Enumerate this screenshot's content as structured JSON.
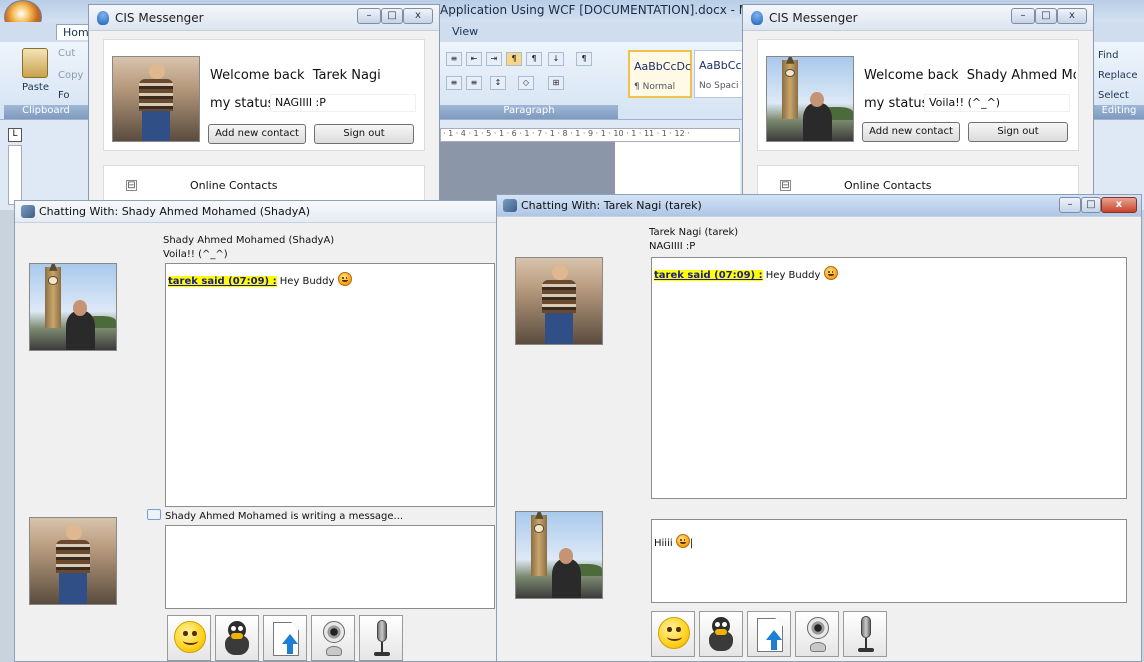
{
  "word": {
    "title": "Application Using WCF [DOCUMENTATION].docx - Microsoft W",
    "tab_home": "Home",
    "tab_view": "View",
    "paste_label": "Paste",
    "cut_label": "Cut",
    "copy_label": "Copy",
    "format_label": "Fo",
    "clipboard_group": "Clipboard",
    "paragraph_group": "Paragraph",
    "editing_group": "Editing",
    "style1_sample": "AaBbCcDc",
    "style1_name": "¶ Normal",
    "style2_sample": "AaBbCc",
    "style2_name": "No Spaci",
    "find_label": "Find",
    "replace_label": "Replace",
    "select_label": "Select",
    "ruler_marks": "· 1 · 4 · 1 · 5 · 1 · 6 · 1 · 7 · 1 · 8 · 1 · 9 · 1 · 10 · 1 · 11 · 1 · 12 ·",
    "ruler_corner": "L"
  },
  "cis_left": {
    "title": "CIS Messenger",
    "welcome": "Welcome back",
    "user_name": "Tarek Nagi",
    "status_label": "my status",
    "status_value": "NAGIIII :P",
    "add_contact": "Add new contact",
    "sign_out": "Sign out",
    "contacts_header": "Online Contacts",
    "expander": "⊟"
  },
  "cis_right": {
    "title": "CIS Messenger",
    "welcome": "Welcome back",
    "user_name": "Shady Ahmed Mohamed",
    "status_label": "my status",
    "status_value": "Voila!! (^_^)",
    "add_contact": "Add new contact",
    "sign_out": "Sign out",
    "contacts_header": "Online Contacts",
    "expander": "⊟"
  },
  "chat_left": {
    "title": "Chatting With: Shady Ahmed Mohamed (ShadyA)",
    "peer_name": "Shady Ahmed Mohamed (ShadyA)",
    "peer_status": "Voila!! (^_^)",
    "messages": [
      {
        "sender": "tarek said (07:09) :",
        "text": "Hey Buddy"
      }
    ],
    "typing_notice": "Shady Ahmed Mohamed is writing a message...",
    "compose_value": ""
  },
  "chat_right": {
    "title": "Chatting With: Tarek Nagi (tarek)",
    "peer_name": "Tarek Nagi (tarek)",
    "peer_status": "NAGIIII :P",
    "messages": [
      {
        "sender": "tarek said (07:09) :",
        "text": "Hey Buddy"
      }
    ],
    "compose_value": "Hiiii"
  },
  "toolbar_icons": [
    "smiley-icon",
    "buddy-icon",
    "send-file-icon",
    "webcam-icon",
    "microphone-icon"
  ],
  "colors": {
    "sender_highlight": "#ffff00",
    "sender_text": "#1b1b8c",
    "titlebar_focused": "#aec6e6"
  }
}
